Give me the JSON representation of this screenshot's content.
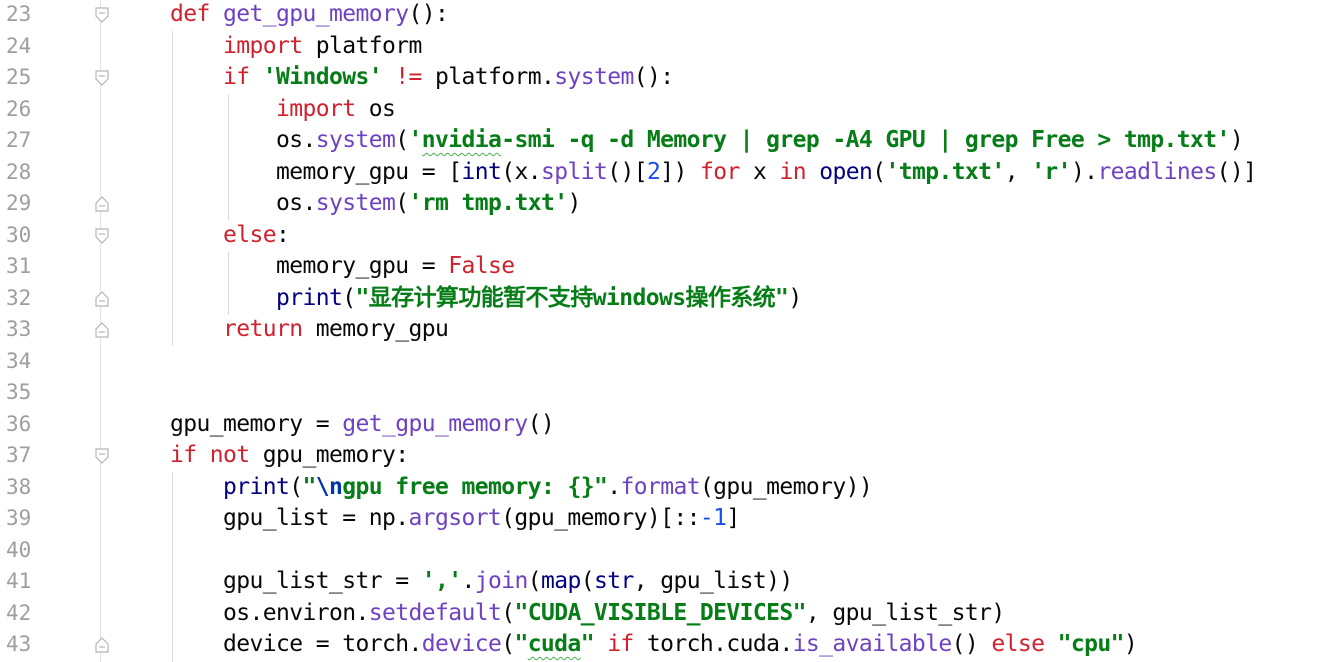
{
  "lines": [
    {
      "no": "23",
      "fold": "open",
      "tokens": [
        {
          "t": "def",
          "c": "kw"
        },
        {
          "t": " "
        },
        {
          "t": "get_gpu_memory",
          "c": "fn"
        },
        {
          "t": "():"
        }
      ]
    },
    {
      "no": "24",
      "tokens": [
        {
          "t": "    "
        },
        {
          "t": "import",
          "c": "kw"
        },
        {
          "t": " platform"
        }
      ]
    },
    {
      "no": "25",
      "fold": "open",
      "tokens": [
        {
          "t": "    "
        },
        {
          "t": "if",
          "c": "kw"
        },
        {
          "t": " "
        },
        {
          "t": "'Windows'",
          "c": "str"
        },
        {
          "t": " "
        },
        {
          "t": "!=",
          "c": "kw"
        },
        {
          "t": " platform."
        },
        {
          "t": "system",
          "c": "fn"
        },
        {
          "t": "():"
        }
      ]
    },
    {
      "no": "26",
      "tokens": [
        {
          "t": "        "
        },
        {
          "t": "import",
          "c": "kw"
        },
        {
          "t": " os"
        }
      ]
    },
    {
      "no": "27",
      "tokens": [
        {
          "t": "        os."
        },
        {
          "t": "system",
          "c": "fn"
        },
        {
          "t": "("
        },
        {
          "t": "'",
          "c": "str"
        },
        {
          "t": "nvidia",
          "c": "str",
          "sq": true
        },
        {
          "t": "-smi -q -d Memory | grep -A4 GPU | grep Free > tmp.txt'",
          "c": "str"
        },
        {
          "t": ")"
        }
      ]
    },
    {
      "no": "28",
      "tokens": [
        {
          "t": "        memory_gpu = ["
        },
        {
          "t": "int",
          "c": "bi"
        },
        {
          "t": "(x."
        },
        {
          "t": "split",
          "c": "fn"
        },
        {
          "t": "()["
        },
        {
          "t": "2",
          "c": "num"
        },
        {
          "t": "]) "
        },
        {
          "t": "for",
          "c": "kw"
        },
        {
          "t": " x "
        },
        {
          "t": "in",
          "c": "kw"
        },
        {
          "t": " "
        },
        {
          "t": "open",
          "c": "bi"
        },
        {
          "t": "("
        },
        {
          "t": "'tmp.txt'",
          "c": "str"
        },
        {
          "t": ", "
        },
        {
          "t": "'r'",
          "c": "str"
        },
        {
          "t": ")."
        },
        {
          "t": "readlines",
          "c": "fn"
        },
        {
          "t": "()]"
        }
      ]
    },
    {
      "no": "29",
      "fold": "close",
      "tokens": [
        {
          "t": "        os."
        },
        {
          "t": "system",
          "c": "fn"
        },
        {
          "t": "("
        },
        {
          "t": "'rm tmp.txt'",
          "c": "str"
        },
        {
          "t": ")"
        }
      ]
    },
    {
      "no": "30",
      "fold": "open",
      "tokens": [
        {
          "t": "    "
        },
        {
          "t": "else",
          "c": "kw"
        },
        {
          "t": ":"
        }
      ]
    },
    {
      "no": "31",
      "tokens": [
        {
          "t": "        memory_gpu = "
        },
        {
          "t": "False",
          "c": "kw"
        }
      ]
    },
    {
      "no": "32",
      "fold": "close",
      "tokens": [
        {
          "t": "        "
        },
        {
          "t": "print",
          "c": "bi"
        },
        {
          "t": "("
        },
        {
          "t": "\"显存计算功能暂不支持windows操作系统\"",
          "c": "str"
        },
        {
          "t": ")"
        }
      ]
    },
    {
      "no": "33",
      "fold": "close",
      "tokens": [
        {
          "t": "    "
        },
        {
          "t": "return",
          "c": "kw"
        },
        {
          "t": " memory_gpu"
        }
      ]
    },
    {
      "no": "34",
      "tokens": []
    },
    {
      "no": "35",
      "tokens": []
    },
    {
      "no": "36",
      "tokens": [
        {
          "t": "gpu_memory = "
        },
        {
          "t": "get_gpu_memory",
          "c": "fn"
        },
        {
          "t": "()"
        }
      ]
    },
    {
      "no": "37",
      "fold": "open",
      "tokens": [
        {
          "t": "if",
          "c": "kw"
        },
        {
          "t": " "
        },
        {
          "t": "not",
          "c": "kw"
        },
        {
          "t": " gpu_memory:"
        }
      ]
    },
    {
      "no": "38",
      "tokens": [
        {
          "t": "    "
        },
        {
          "t": "print",
          "c": "bi"
        },
        {
          "t": "("
        },
        {
          "t": "\"",
          "c": "str"
        },
        {
          "t": "\\n",
          "c": "esc"
        },
        {
          "t": "gpu free memory: {}\"",
          "c": "str"
        },
        {
          "t": "."
        },
        {
          "t": "format",
          "c": "fn"
        },
        {
          "t": "(gpu_memory))"
        }
      ]
    },
    {
      "no": "39",
      "tokens": [
        {
          "t": "    gpu_list = np."
        },
        {
          "t": "argsort",
          "c": "fn"
        },
        {
          "t": "(gpu_memory)[::"
        },
        {
          "t": "-1",
          "c": "num"
        },
        {
          "t": "]"
        }
      ]
    },
    {
      "no": "40",
      "tokens": []
    },
    {
      "no": "41",
      "tokens": [
        {
          "t": "    gpu_list_str = "
        },
        {
          "t": "','",
          "c": "str"
        },
        {
          "t": "."
        },
        {
          "t": "join",
          "c": "fn"
        },
        {
          "t": "("
        },
        {
          "t": "map",
          "c": "bi"
        },
        {
          "t": "("
        },
        {
          "t": "str",
          "c": "bi"
        },
        {
          "t": ", gpu_list))"
        }
      ]
    },
    {
      "no": "42",
      "tokens": [
        {
          "t": "    os.environ."
        },
        {
          "t": "setdefault",
          "c": "fn"
        },
        {
          "t": "("
        },
        {
          "t": "\"CUDA_VISIBLE_DEVICES\"",
          "c": "str"
        },
        {
          "t": ", gpu_list_str)"
        }
      ]
    },
    {
      "no": "43",
      "fold": "close",
      "tokens": [
        {
          "t": "    device = torch."
        },
        {
          "t": "device",
          "c": "fn"
        },
        {
          "t": "("
        },
        {
          "t": "\"",
          "c": "str"
        },
        {
          "t": "cuda",
          "c": "str",
          "sq": true
        },
        {
          "t": "\"",
          "c": "str"
        },
        {
          "t": " "
        },
        {
          "t": "if",
          "c": "kw"
        },
        {
          "t": " torch.cuda."
        },
        {
          "t": "is_available",
          "c": "fn"
        },
        {
          "t": "() "
        },
        {
          "t": "else",
          "c": "kw"
        },
        {
          "t": " "
        },
        {
          "t": "\"cpu\"",
          "c": "str"
        },
        {
          "t": ")"
        }
      ]
    }
  ]
}
